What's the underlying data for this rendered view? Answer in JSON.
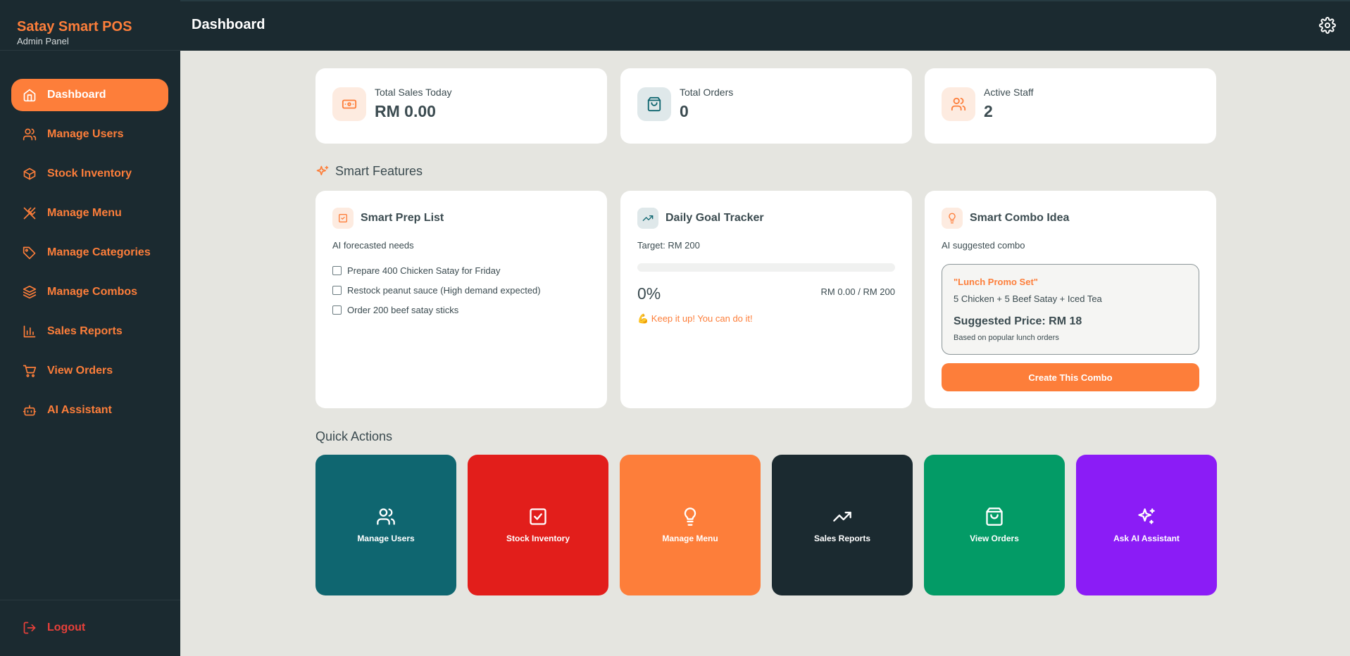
{
  "brand": {
    "title": "Satay Smart POS",
    "subtitle": "Admin Panel"
  },
  "nav": [
    {
      "label": "Dashboard",
      "icon": "home-icon",
      "active": true
    },
    {
      "label": "Manage Users",
      "icon": "users-icon"
    },
    {
      "label": "Stock Inventory",
      "icon": "box-icon"
    },
    {
      "label": "Manage Menu",
      "icon": "utensils-icon"
    },
    {
      "label": "Manage Categories",
      "icon": "tags-icon"
    },
    {
      "label": "Manage Combos",
      "icon": "layers-icon"
    },
    {
      "label": "Sales Reports",
      "icon": "bar-chart-icon"
    },
    {
      "label": "View Orders",
      "icon": "cart-icon"
    },
    {
      "label": "AI Assistant",
      "icon": "bot-icon"
    }
  ],
  "logout": {
    "label": "Logout"
  },
  "header": {
    "title": "Dashboard"
  },
  "stats": [
    {
      "label": "Total Sales Today",
      "value": "RM 0.00",
      "icon": "banknote-icon"
    },
    {
      "label": "Total Orders",
      "value": "0",
      "icon": "shopping-bag-icon"
    },
    {
      "label": "Active Staff",
      "value": "2",
      "icon": "users-icon"
    }
  ],
  "smart": {
    "title": "Smart Features",
    "prep": {
      "title": "Smart Prep List",
      "subtitle": "AI forecasted needs",
      "items": [
        "Prepare 400 Chicken Satay for Friday",
        "Restock peanut sauce (High demand expected)",
        "Order 200 beef satay sticks"
      ]
    },
    "goal": {
      "title": "Daily Goal Tracker",
      "target": "Target: RM 200",
      "percent_label": "0%",
      "progress": 0,
      "amount": "RM 0.00 / RM 200",
      "message": "💪 Keep it up! You can do it!"
    },
    "combo": {
      "title": "Smart Combo Idea",
      "subtitle": "AI suggested combo",
      "name": "\"Lunch Promo Set\"",
      "items": "5 Chicken + 5 Beef Satay + Iced Tea",
      "price": "Suggested Price: RM 18",
      "note": "Based on popular lunch orders",
      "button": "Create This Combo"
    }
  },
  "quick_actions": {
    "title": "Quick Actions",
    "items": [
      {
        "label": "Manage Users",
        "color": "#0f6670",
        "icon": "users-icon"
      },
      {
        "label": "Stock Inventory",
        "color": "#e21e1b",
        "icon": "check-square-icon"
      },
      {
        "label": "Manage Menu",
        "color": "#fd7e3a",
        "icon": "lightbulb-icon"
      },
      {
        "label": "Sales Reports",
        "color": "#1b2a30",
        "icon": "trending-up-icon"
      },
      {
        "label": "View Orders",
        "color": "#039b66",
        "icon": "shopping-bag-icon"
      },
      {
        "label": "Ask AI Assistant",
        "color": "#8b1cf6",
        "icon": "sparkles-icon"
      }
    ]
  },
  "colors": {
    "accent": "#fd7e3a",
    "sidebar": "#1b2a30",
    "background": "#e5e5e0",
    "danger": "#e8403a"
  }
}
